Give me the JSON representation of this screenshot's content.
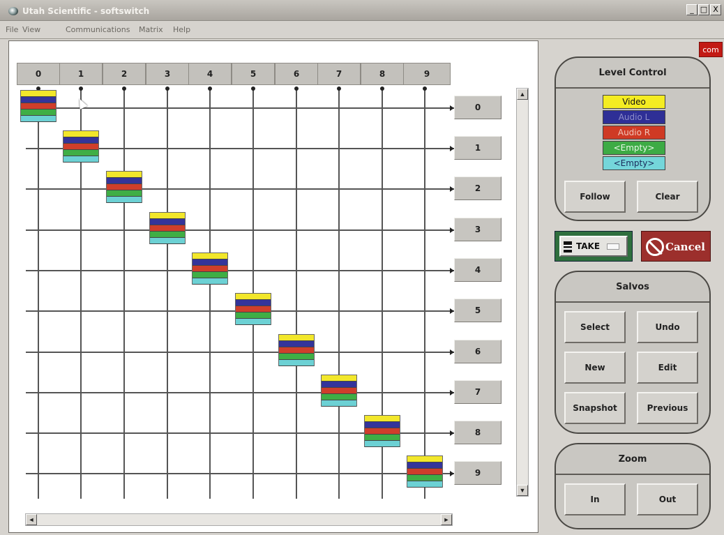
{
  "window": {
    "title": "Utah Scientific - softswitch",
    "controls": [
      "_",
      "□",
      "X"
    ]
  },
  "menu": [
    "File",
    "View",
    "Communications",
    "Matrix",
    "Help"
  ],
  "matrix": {
    "inputs": [
      "0",
      "1",
      "2",
      "3",
      "4",
      "5",
      "6",
      "7",
      "8",
      "9"
    ],
    "outputs": [
      "0",
      "1",
      "2",
      "3",
      "4",
      "5",
      "6",
      "7",
      "8",
      "9"
    ],
    "level_colors": [
      "#f2e72b",
      "#34349a",
      "#cf3e2b",
      "#3fae45",
      "#6cd1d4"
    ],
    "scroll": {
      "up": "▲",
      "down": "▼",
      "left": "◄",
      "right": "►"
    }
  },
  "com_badge": "com",
  "level_control": {
    "title": "Level Control",
    "levels": [
      {
        "label": "Video",
        "bg": "#f4ec22",
        "fg": "#111111"
      },
      {
        "label": "Audio L",
        "bg": "#2e2f96",
        "fg": "#8e8ec9"
      },
      {
        "label": "Audio R",
        "bg": "#cf3a24",
        "fg": "#f2c5b9"
      },
      {
        "label": "<Empty>",
        "bg": "#3dab45",
        "fg": "#e7f8e6"
      },
      {
        "label": "<Empty>",
        "bg": "#74d6da",
        "fg": "#1a2a5a"
      }
    ],
    "follow": "Follow",
    "clear": "Clear"
  },
  "take": {
    "label": "TAKE"
  },
  "cancel": {
    "label": "Cancel"
  },
  "salvos": {
    "title": "Salvos",
    "select": "Select",
    "undo": "Undo",
    "new": "New",
    "edit": "Edit",
    "snapshot": "Snapshot",
    "previous": "Previous"
  },
  "zoom": {
    "title": "Zoom",
    "in": "In",
    "out": "Out"
  }
}
